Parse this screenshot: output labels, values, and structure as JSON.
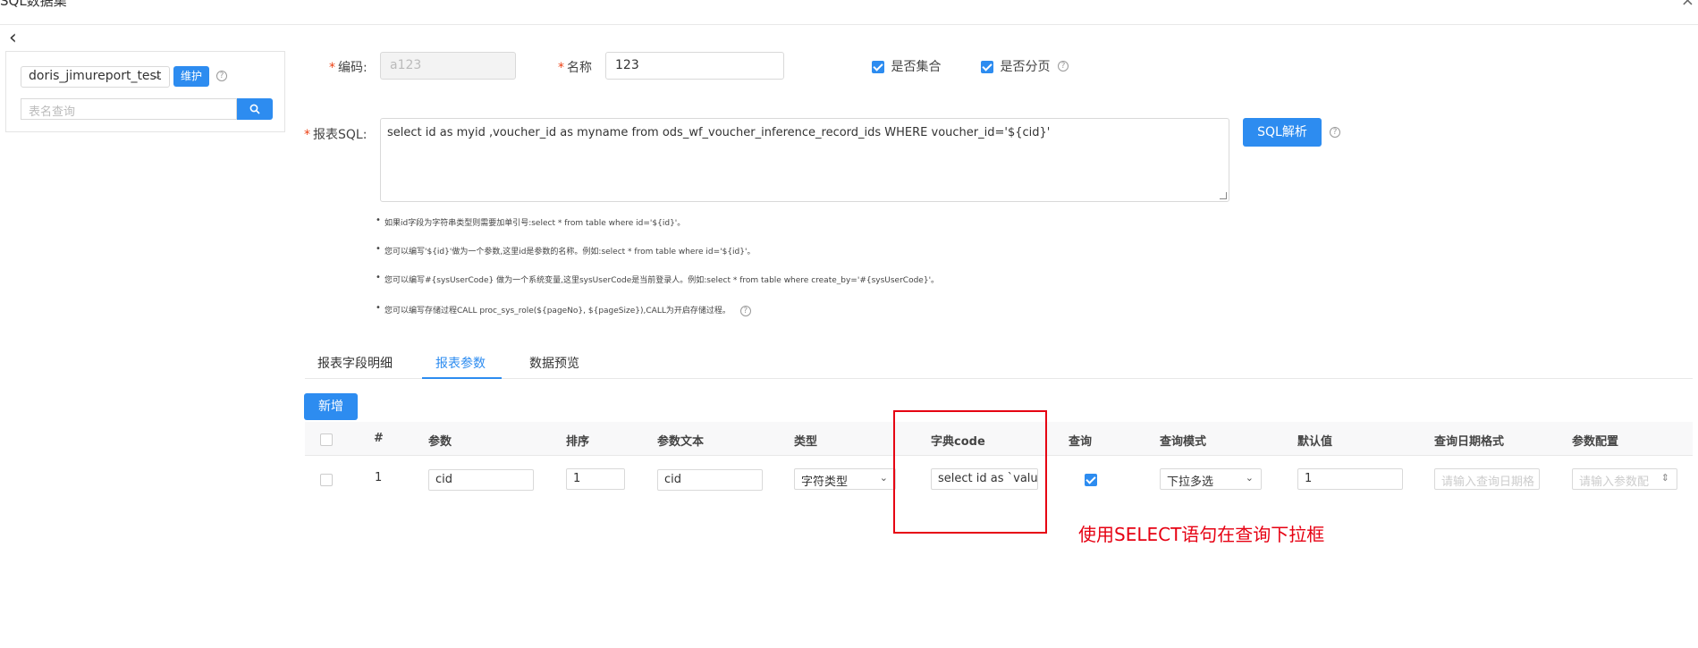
{
  "window": {
    "title": "SQL数据集",
    "close_icon": "×"
  },
  "back_icon": "‹",
  "left_panel": {
    "datasource_value": "doris_jimureport_test",
    "maintain_label": "维护",
    "table_search_placeholder": "表名查询"
  },
  "form": {
    "code_label": "编码:",
    "code_value": "a123",
    "name_label": "名称",
    "name_value": "123",
    "is_collection_label": "是否集合",
    "is_paging_label": "是否分页",
    "sql_label": "报表SQL:",
    "sql_value": "select id as myid ,voucher_id as myname from ods_wf_voucher_inference_record_ids WHERE  voucher_id='${cid}'",
    "sql_parse_label": "SQL解析"
  },
  "tips": [
    "如果id字段为字符串类型则需要加单引号:select * from table where id='${id}'。",
    "您可以编写'${id}'做为一个参数,这里id是参数的名称。例如:select * from table where id='${id}'。",
    "您可以编写#{sysUserCode} 做为一个系统变量,这里sysUserCode是当前登录人。例如:select * from table where create_by='#{sysUserCode}'。",
    "您可以编写存储过程CALL proc_sys_role(${pageNo}, ${pageSize}),CALL为开启存储过程。"
  ],
  "tabs": [
    "报表字段明细",
    "报表参数",
    "数据预览"
  ],
  "add_label": "新增",
  "grid": {
    "headers": [
      "#",
      "参数",
      "排序",
      "参数文本",
      "类型",
      "字典code",
      "查询",
      "查询模式",
      "默认值",
      "查询日期格式",
      "参数配置"
    ],
    "row": {
      "index": "1",
      "param": "cid",
      "order": "1",
      "param_text": "cid",
      "type": "字符类型",
      "dict_code": "select id as `valu",
      "query_mode": "下拉多选",
      "default_value": "1",
      "date_format_placeholder": "请输入查询日期格",
      "param_config_placeholder": "请输入参数配"
    }
  },
  "annotation": "使用SELECT语句在查询下拉框",
  "colors": {
    "accent": "#2d8cf0",
    "annotation": "#e60012"
  }
}
